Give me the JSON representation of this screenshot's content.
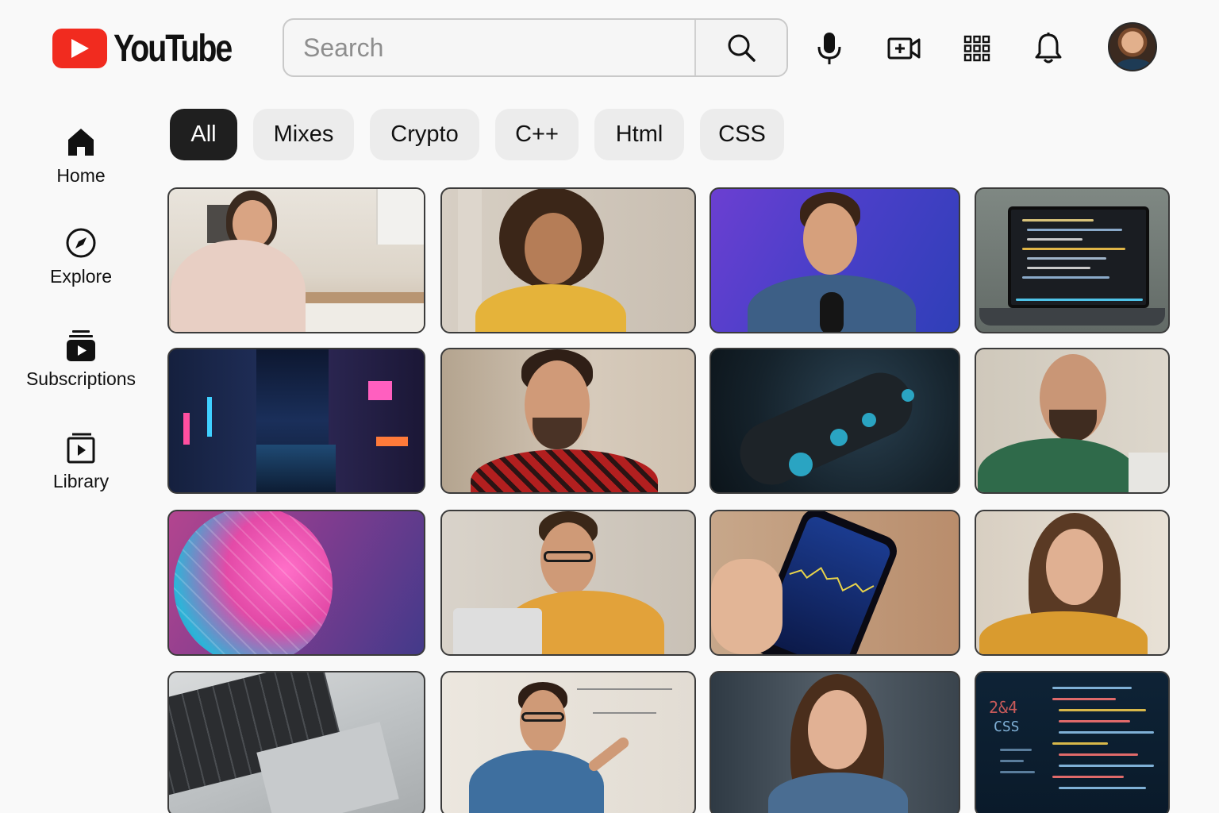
{
  "header": {
    "logo_text": "YouTube",
    "search_placeholder": "Search",
    "icons": [
      "search-icon",
      "microphone-icon",
      "create-video-icon",
      "apps-grid-icon",
      "notifications-bell-icon"
    ]
  },
  "sidebar": {
    "items": [
      {
        "label": "Home",
        "icon": "home-icon"
      },
      {
        "label": "Explore",
        "icon": "compass-icon"
      },
      {
        "label": "Subscriptions",
        "icon": "subscriptions-icon"
      },
      {
        "label": "Library",
        "icon": "library-icon"
      }
    ]
  },
  "chips": [
    {
      "label": "All",
      "active": true
    },
    {
      "label": "Mixes",
      "active": false
    },
    {
      "label": "Crypto",
      "active": false
    },
    {
      "label": "C++",
      "active": false
    },
    {
      "label": "Html",
      "active": false
    },
    {
      "label": "CSS",
      "active": false
    }
  ],
  "thumbnails": [
    {
      "subject": "woman-cooking-in-kitchen"
    },
    {
      "subject": "smiling-woman-curly-hair"
    },
    {
      "subject": "man-with-microphone-purple-background"
    },
    {
      "subject": "laptop-with-code"
    },
    {
      "subject": "neon-city-street"
    },
    {
      "subject": "smiling-man-plaid-shirt"
    },
    {
      "subject": "robotic-hand"
    },
    {
      "subject": "man-green-sweater"
    },
    {
      "subject": "pink-blue-abstract-sphere"
    },
    {
      "subject": "man-glasses-laptop"
    },
    {
      "subject": "phone-crypto-chart"
    },
    {
      "subject": "woman-long-brown-hair"
    },
    {
      "subject": "laptop-keyboard-closeup"
    },
    {
      "subject": "man-at-whiteboard"
    },
    {
      "subject": "woman-smiling-indoors"
    },
    {
      "subject": "css-code-screen"
    }
  ],
  "colors": {
    "brand_red": "#f12b1f",
    "chip_active_bg": "#1f1f1f",
    "chip_bg": "#ececec",
    "page_bg": "#f9f9f9"
  }
}
